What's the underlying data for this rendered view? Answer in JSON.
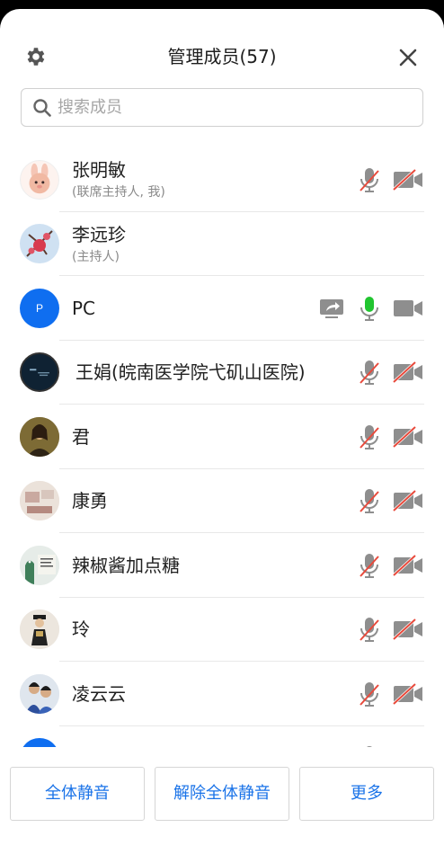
{
  "header": {
    "title": "管理成员(57)",
    "settings_icon": "gear-icon",
    "close_icon": "close-icon"
  },
  "search": {
    "placeholder": "搜索成员",
    "value": ""
  },
  "colors": {
    "accent": "#1a73e8",
    "mic_active": "#21c530",
    "muted_slash": "#e84a3c",
    "icon_gray": "#8e8e8e"
  },
  "members": [
    {
      "name": "张明敏",
      "role": "(联席主持人, 我)",
      "avatar": "bunny-avatar",
      "mic": "muted",
      "camera": "off"
    },
    {
      "name": "李远珍",
      "role": "(主持人)",
      "avatar": "flower-avatar"
    },
    {
      "name": "PC",
      "role": "",
      "avatar_letter": "P",
      "sharing": true,
      "mic": "active",
      "camera": "on"
    },
    {
      "name": "王娟(皖南医学院弋矶山医院)",
      "role": "",
      "avatar": "slide-avatar",
      "mic": "muted",
      "camera": "off"
    },
    {
      "name": "君",
      "role": "",
      "avatar": "portrait-avatar",
      "mic": "muted",
      "camera": "off"
    },
    {
      "name": "康勇",
      "role": "",
      "avatar": "photo-avatar",
      "mic": "muted",
      "camera": "off"
    },
    {
      "name": "辣椒酱加点糖",
      "role": "",
      "avatar": "sign-avatar",
      "mic": "muted",
      "camera": "off"
    },
    {
      "name": "玲",
      "role": "",
      "avatar": "person-avatar",
      "mic": "muted",
      "camera": "off"
    },
    {
      "name": "凌云云",
      "role": "",
      "avatar": "kids-avatar",
      "mic": "muted",
      "camera": "off"
    }
  ],
  "footer": {
    "mute_all": "全体静音",
    "unmute_all": "解除全体静音",
    "more": "更多"
  }
}
